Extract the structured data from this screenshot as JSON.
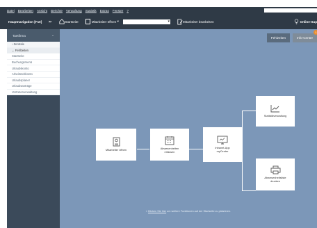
{
  "menu": {
    "items": [
      "Datei",
      "Bearbeiten",
      "Ansicht",
      "Berichte",
      "Verwaltung",
      "Statistik",
      "Extras",
      "Fenster",
      "?"
    ]
  },
  "toolbar": {
    "nav_label": "Hauptnavigation [F10]",
    "startseite": "Startseite",
    "mitarbeiter_oeffnen": "Mitarbeiter öffnen",
    "combo_value": "",
    "mitarbeiter_bearbeiten": "Mitarbeiter bearbeiten",
    "online": "Online-Sup"
  },
  "sidebar": {
    "filter": "Taetfirma",
    "items": [
      {
        "label": "Zentrale",
        "type": "section"
      },
      {
        "label": "Fehlzeiten",
        "type": "active"
      },
      {
        "label": "Startseite",
        "type": "normal"
      },
      {
        "label": "Buchungsmenü",
        "type": "normal"
      },
      {
        "label": "Urlaubskonto",
        "type": "normal"
      },
      {
        "label": "Arbeitszeitkonto",
        "type": "normal"
      },
      {
        "label": "Urlaubsplaner",
        "type": "normal"
      },
      {
        "label": "Urlaubsanträge",
        "type": "normal"
      },
      {
        "label": "Vertreterverwaltung",
        "type": "normal"
      }
    ]
  },
  "tabs": {
    "fehlzeiten": "Fehlzeiten",
    "info_center": "Info-Center",
    "info_badge": "1"
  },
  "cards": {
    "mitarbeiter": "Mitarbeiter öffnen",
    "abwesenheiten_1": "Abwesenheiten",
    "abwesenheiten_2": "erfassen",
    "intranet_1": "Intranet-App",
    "intranet_2": "myCenter",
    "statistik": "Statistikverwaltung",
    "liste_1": "Abwesenheitsliste",
    "liste_2": "drucken"
  },
  "hint": {
    "prefix": "» ",
    "link": "Klicken Sie hier",
    "suffix": " um weitere Funktionen auf der Startseite zu platzieren."
  },
  "colors": {
    "header": "#2f3a46",
    "sidebar": "#3b4a5a",
    "main_bg": "#7c97b8",
    "accent": "#e88c2e"
  }
}
